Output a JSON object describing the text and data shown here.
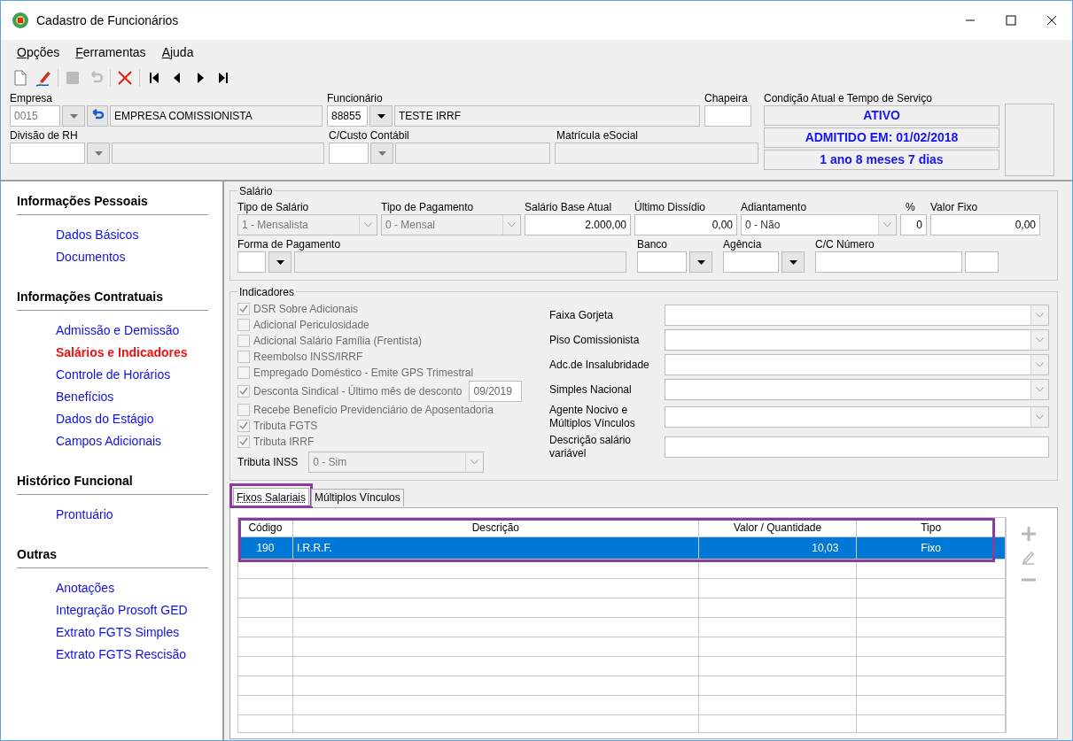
{
  "window": {
    "title": "Cadastro de Funcionários"
  },
  "menu": [
    "Opções",
    "Ferramentas",
    "Ajuda"
  ],
  "toolbar": [
    {
      "kind": "new",
      "disabled": false
    },
    {
      "kind": "edit",
      "disabled": false
    },
    {
      "kind": "save",
      "disabled": true
    },
    {
      "kind": "undo",
      "disabled": true
    },
    {
      "kind": "delete",
      "disabled": false
    },
    {
      "kind": "first",
      "disabled": false
    },
    {
      "kind": "prev",
      "disabled": false
    },
    {
      "kind": "next",
      "disabled": false
    },
    {
      "kind": "last",
      "disabled": false
    }
  ],
  "header": {
    "empresa": {
      "label": "Empresa",
      "code": "0015",
      "name": "EMPRESA COMISSIONISTA"
    },
    "funcionario": {
      "label": "Funcionário",
      "code": "88855",
      "name": "TESTE IRRF"
    },
    "chapeira": {
      "label": "Chapeira"
    },
    "divisao": {
      "label": "Divisão de RH"
    },
    "custo": {
      "label": "C/Custo Contábil"
    },
    "matricula": {
      "label": "Matrícula eSocial"
    },
    "condicao": {
      "label": "Condição Atual e Tempo de Serviço",
      "lines": [
        "ATIVO",
        "ADMITIDO EM: 01/02/2018",
        "1 ano 8 meses 7 dias"
      ]
    }
  },
  "sidebar": [
    {
      "title": "Informações Pessoais",
      "items": [
        {
          "label": "Dados Básicos",
          "selected": false
        },
        {
          "label": "Documentos",
          "selected": false
        }
      ]
    },
    {
      "title": "Informações Contratuais",
      "items": [
        {
          "label": "Admissão e Demissão",
          "selected": false
        },
        {
          "label": "Salários e Indicadores",
          "selected": true
        },
        {
          "label": "Controle de Horários",
          "selected": false
        },
        {
          "label": "Benefícios",
          "selected": false
        },
        {
          "label": "Dados do Estágio",
          "selected": false
        },
        {
          "label": "Campos Adicionais",
          "selected": false
        }
      ]
    },
    {
      "title": "Histórico Funcional",
      "items": [
        {
          "label": "Prontuário",
          "selected": false
        }
      ]
    },
    {
      "title": "Outras",
      "items": [
        {
          "label": "Anotações",
          "selected": false
        },
        {
          "label": "Integração Prosoft GED",
          "selected": false
        },
        {
          "label": "Extrato FGTS Simples",
          "selected": false
        },
        {
          "label": "Extrato FGTS Rescisão",
          "selected": false
        }
      ]
    }
  ],
  "salario": {
    "title": "Salário",
    "row1": [
      {
        "label": "Tipo de Salário",
        "kind": "select",
        "value": "1 - Mensalista",
        "disabled": true
      },
      {
        "label": "Tipo de Pagamento",
        "kind": "select",
        "value": "0 - Mensal",
        "disabled": true
      },
      {
        "label": "Salário Base Atual",
        "kind": "number",
        "value": "2.000,00"
      },
      {
        "label": "Último Dissídio",
        "kind": "number",
        "value": "0,00"
      },
      {
        "label": "Adiantamento",
        "kind": "select",
        "value": "0 - Não",
        "disabled": false
      },
      {
        "label": "%",
        "kind": "number",
        "value": "0"
      },
      {
        "label": "Valor Fixo",
        "kind": "number",
        "value": "0,00"
      }
    ],
    "row2": [
      {
        "label": "Forma de Pagamento",
        "kind": "lookup"
      },
      {
        "label": "Banco",
        "kind": "combo"
      },
      {
        "label": "Agência",
        "kind": "combo"
      },
      {
        "label": "C/C Número",
        "kind": "account"
      }
    ]
  },
  "indicadores": {
    "title": "Indicadores",
    "checks": [
      {
        "label": "DSR Sobre Adicionais",
        "checked": true
      },
      {
        "label": "Adicional Periculosidade",
        "checked": false
      },
      {
        "label": "Adicional Salário Família (Frentista)",
        "checked": false
      },
      {
        "label": "Reembolso INSS/IRRF",
        "checked": false
      },
      {
        "label": "Empregado Doméstico - Emite GPS Trimestral",
        "checked": false
      },
      {
        "label": "Desconta Sindical - Último mês de desconto",
        "checked": true,
        "value": "09/2019"
      },
      {
        "label": "Recebe Benefício Previdenciário de Aposentadoria",
        "checked": false
      },
      {
        "label": "Tributa FGTS",
        "checked": true
      },
      {
        "label": "Tributa IRRF",
        "checked": true
      }
    ],
    "tributa_inss": {
      "label": "Tributa INSS",
      "value": "0 - Sim"
    },
    "right": [
      {
        "label": "Faixa Gorjeta",
        "kind": "select"
      },
      {
        "label": "Piso Comissionista",
        "kind": "select"
      },
      {
        "label": "Adc.de Insalubridade",
        "kind": "select"
      },
      {
        "label": "Simples Nacional",
        "kind": "select"
      },
      {
        "label": "Agente Nocivo e Múltiplos Vínculos",
        "kind": "select"
      },
      {
        "label": "Descrição salário variável",
        "kind": "text"
      }
    ]
  },
  "tabs": [
    {
      "label": "Fixos Salariais",
      "selected": true,
      "highlighted": true
    },
    {
      "label": "Múltiplos Vínculos",
      "selected": false,
      "highlighted": false
    }
  ],
  "table": {
    "highlighted": true,
    "columns": [
      "Código",
      "Descrição",
      "Valor / Quantidade",
      "Tipo"
    ],
    "rows": [
      {
        "cells": [
          "190",
          "I.R.R.F.",
          "10,03",
          "Fixo"
        ],
        "selected": true
      }
    ]
  },
  "side_buttons": [
    {
      "kind": "add",
      "disabled": true
    },
    {
      "kind": "edit",
      "disabled": true
    },
    {
      "kind": "remove",
      "disabled": true
    }
  ]
}
